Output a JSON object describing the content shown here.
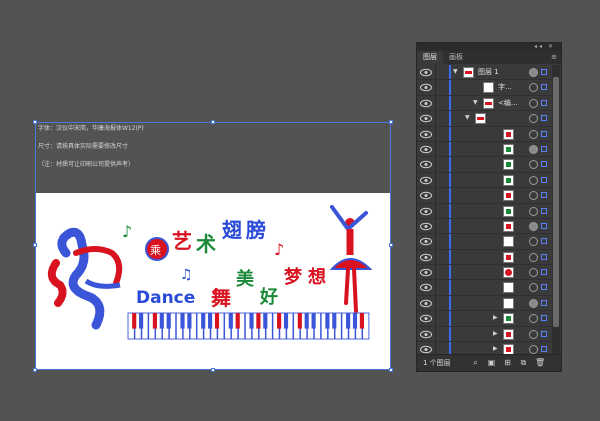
{
  "artboard": {
    "notes": [
      "字体：汉仪中宋简，华康海报体W12(P)",
      "尺寸：请按具体实际需要修改尺寸",
      "（注：材质可让印刷公司提供声考）"
    ],
    "artwork": {
      "title_chars": [
        "艺",
        "术",
        "翅",
        "膀"
      ],
      "badge_char": "乘",
      "dance_word": "Dance",
      "subtitle_chars": [
        "舞",
        "美",
        "好",
        "梦",
        "想"
      ]
    }
  },
  "layers_panel": {
    "tabs": [
      "图层",
      "画板"
    ],
    "layer_count": "1 个图层",
    "rows": [
      {
        "name": "图层 1",
        "indent": 0,
        "expanded": true,
        "thumb": "logo"
      },
      {
        "name": "字...",
        "indent": 1,
        "thumb": "plain"
      },
      {
        "name": "<编...",
        "indent": 1,
        "expanded": true,
        "thumb": "logo"
      },
      {
        "name": "",
        "indent": 2,
        "expanded": true,
        "thumb": "logo"
      },
      {
        "name": "",
        "indent": 3,
        "thumb": "red"
      },
      {
        "name": "",
        "indent": 3,
        "thumb": "green"
      },
      {
        "name": "",
        "indent": 3,
        "thumb": "green"
      },
      {
        "name": "",
        "indent": 3,
        "thumb": "green"
      },
      {
        "name": "",
        "indent": 3,
        "thumb": "red"
      },
      {
        "name": "",
        "indent": 3,
        "thumb": "green"
      },
      {
        "name": "",
        "indent": 3,
        "thumb": "red"
      },
      {
        "name": "",
        "indent": 3,
        "thumb": "plain"
      },
      {
        "name": "",
        "indent": 3,
        "thumb": "red"
      },
      {
        "name": "",
        "indent": 3,
        "thumb": "reddot"
      },
      {
        "name": "",
        "indent": 3,
        "thumb": "plain"
      },
      {
        "name": "",
        "indent": 3,
        "thumb": "plain"
      },
      {
        "name": "",
        "indent": 3,
        "expanded": false,
        "thumb": "green"
      },
      {
        "name": "",
        "indent": 3,
        "expanded": false,
        "thumb": "red"
      },
      {
        "name": "",
        "indent": 3,
        "expanded": false,
        "thumb": "red"
      }
    ]
  },
  "colors": {
    "red": "#d8121f",
    "green": "#1a8a3a",
    "blue": "#2a4bd8",
    "selection": "#4a78d8"
  }
}
